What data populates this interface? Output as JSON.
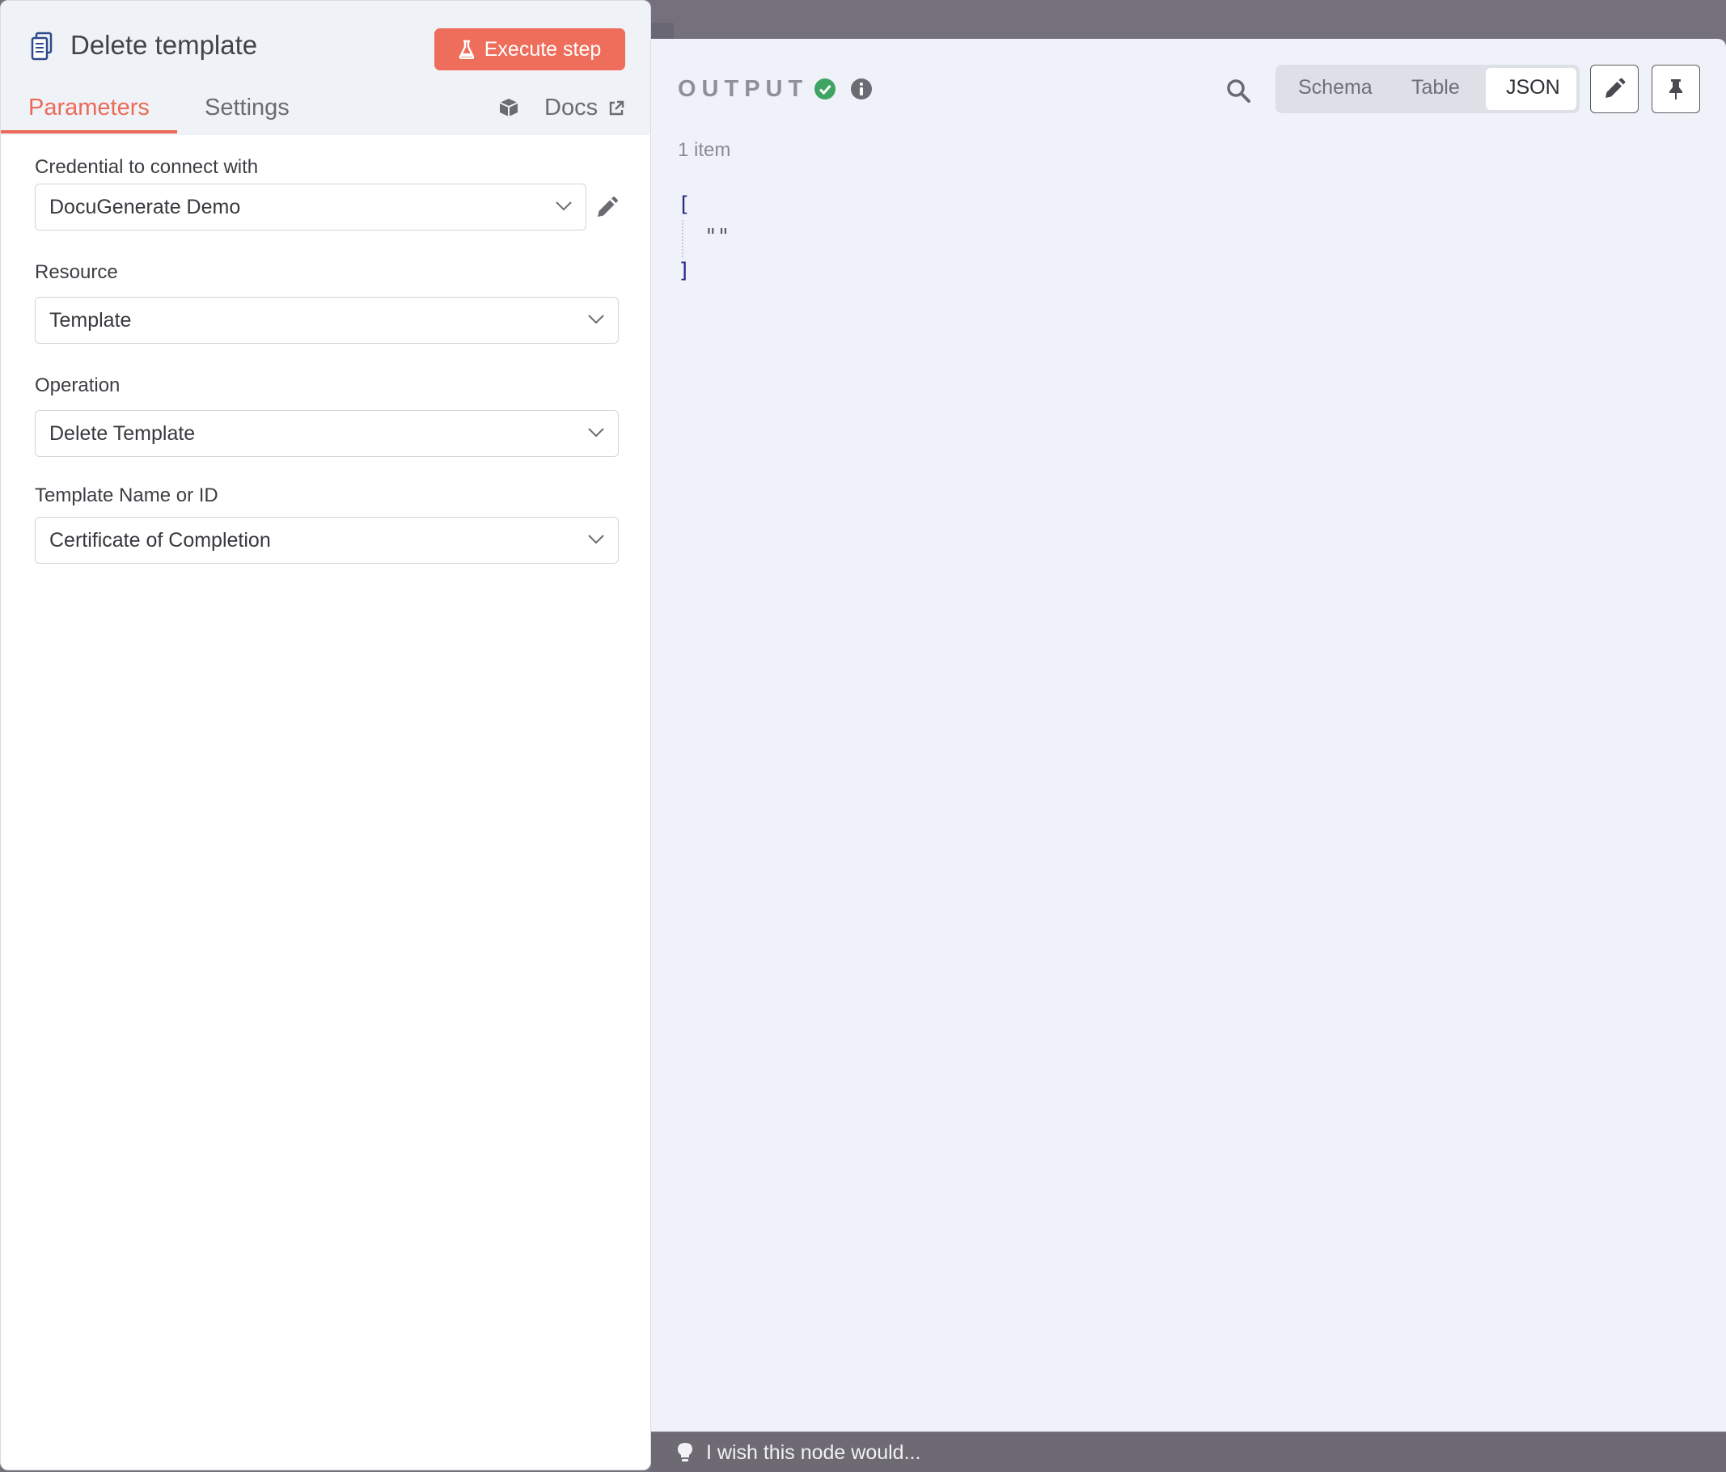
{
  "node": {
    "title": "Delete template",
    "icon": "document-icon",
    "execute_label": "Execute step",
    "accent_color": "#ee6e5b"
  },
  "tabs": {
    "parameters": "Parameters",
    "settings": "Settings",
    "docs": "Docs"
  },
  "fields": {
    "credential": {
      "label": "Credential to connect with",
      "value": "DocuGenerate Demo"
    },
    "resource": {
      "label": "Resource",
      "value": "Template"
    },
    "operation": {
      "label": "Operation",
      "value": "Delete Template"
    },
    "template": {
      "label": "Template Name or ID",
      "value": "Certificate of Completion"
    }
  },
  "output": {
    "title": "OUTPUT",
    "status_color": "#3fa463",
    "views": [
      "Schema",
      "Table",
      "JSON"
    ],
    "active_view": "JSON",
    "item_count": "1 item",
    "json": {
      "open": "[",
      "value": "\"\"",
      "close": "]"
    }
  },
  "feedback": {
    "text": "I wish this node would..."
  }
}
